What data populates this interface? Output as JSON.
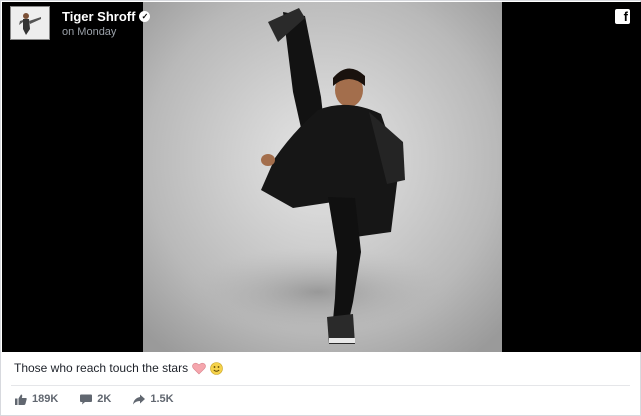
{
  "post": {
    "author": "Tiger Shroff",
    "time": "on Monday",
    "caption": "Those who reach touch the stars",
    "verified_icon": "verified-badge-icon",
    "platform_icon": "facebook-logo-icon",
    "platform_glyph": "f"
  },
  "stats": {
    "likes": "189K",
    "comments": "2K",
    "shares": "1.5K"
  },
  "colors": {
    "media_bg": "#000000",
    "heart": "#f5a6ad",
    "emoji": "#f5d24a",
    "action_text": "#616770"
  }
}
